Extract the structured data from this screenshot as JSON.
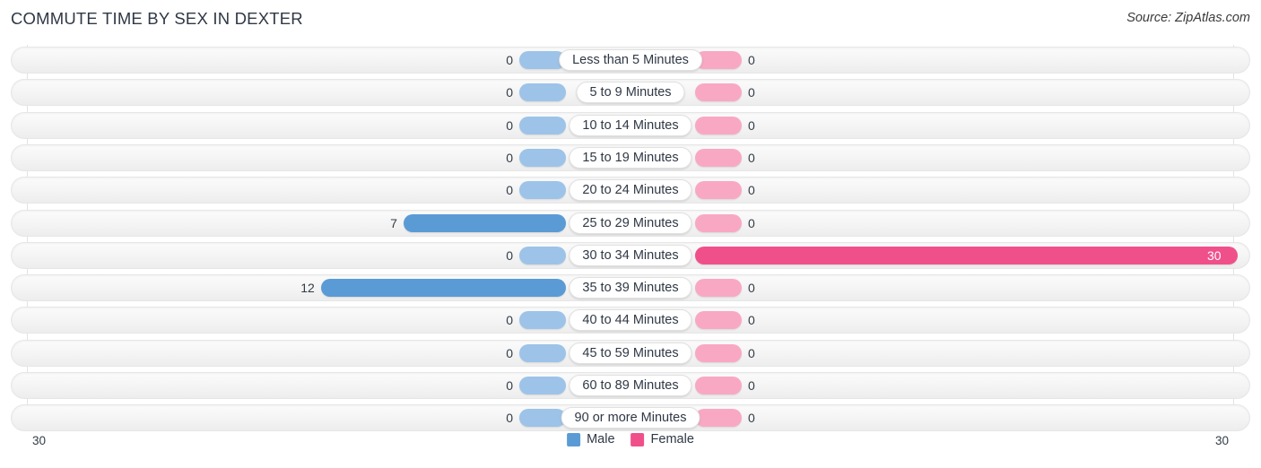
{
  "header": {
    "title": "COMMUTE TIME BY SEX IN DEXTER",
    "source": "Source: ZipAtlas.com"
  },
  "axis": {
    "left_value": "30",
    "right_value": "30"
  },
  "legend": {
    "items": [
      {
        "label": "Male",
        "color": "#5b9bd5"
      },
      {
        "label": "Female",
        "color": "#f0508a"
      }
    ]
  },
  "colors": {
    "male_zero": "#9dc3e8",
    "male_value": "#5b9bd5",
    "female_zero": "#f9a8c4",
    "female_value": "#f0508a",
    "track": "#f4f4f4",
    "gridline": "#e3e3e3",
    "title": "#2f3845"
  },
  "chart_data": {
    "type": "bar",
    "title": "COMMUTE TIME BY SEX IN DEXTER",
    "subtitle": "",
    "xlabel": "",
    "ylabel": "",
    "orientation": "horizontal-diverging",
    "axis_max": 30,
    "axis_left_tick": "30",
    "axis_right_tick": "30",
    "grid": true,
    "legend_position": "bottom-center",
    "categories": [
      "Less than 5 Minutes",
      "5 to 9 Minutes",
      "10 to 14 Minutes",
      "15 to 19 Minutes",
      "20 to 24 Minutes",
      "25 to 29 Minutes",
      "30 to 34 Minutes",
      "35 to 39 Minutes",
      "40 to 44 Minutes",
      "45 to 59 Minutes",
      "60 to 89 Minutes",
      "90 or more Minutes"
    ],
    "series": [
      {
        "name": "Male",
        "values": [
          0,
          0,
          0,
          0,
          0,
          7,
          0,
          12,
          0,
          0,
          0,
          0
        ]
      },
      {
        "name": "Female",
        "values": [
          0,
          0,
          0,
          0,
          0,
          0,
          30,
          0,
          0,
          0,
          0,
          0
        ]
      }
    ]
  },
  "rows": [
    {
      "label": "Less than 5 Minutes",
      "male": "0",
      "female": "0"
    },
    {
      "label": "5 to 9 Minutes",
      "male": "0",
      "female": "0"
    },
    {
      "label": "10 to 14 Minutes",
      "male": "0",
      "female": "0"
    },
    {
      "label": "15 to 19 Minutes",
      "male": "0",
      "female": "0"
    },
    {
      "label": "20 to 24 Minutes",
      "male": "0",
      "female": "0"
    },
    {
      "label": "25 to 29 Minutes",
      "male": "7",
      "female": "0"
    },
    {
      "label": "30 to 34 Minutes",
      "male": "0",
      "female": "30"
    },
    {
      "label": "35 to 39 Minutes",
      "male": "12",
      "female": "0"
    },
    {
      "label": "40 to 44 Minutes",
      "male": "0",
      "female": "0"
    },
    {
      "label": "45 to 59 Minutes",
      "male": "0",
      "female": "0"
    },
    {
      "label": "60 to 89 Minutes",
      "male": "0",
      "female": "0"
    },
    {
      "label": "90 or more Minutes",
      "male": "0",
      "female": "0"
    }
  ]
}
